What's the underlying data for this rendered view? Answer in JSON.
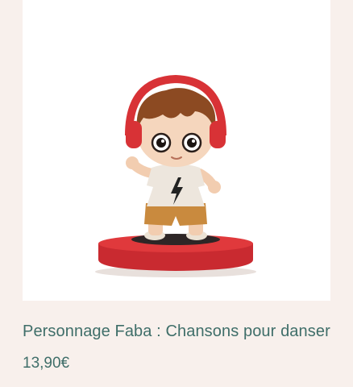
{
  "product": {
    "title": "Personnage Faba : Chansons pour danser",
    "price": "13,90€",
    "colors": {
      "background": "#f8f0ec",
      "card": "#ffffff",
      "text": "#3f6e69"
    }
  },
  "image": {
    "subject": "figurine-with-red-headphones"
  }
}
